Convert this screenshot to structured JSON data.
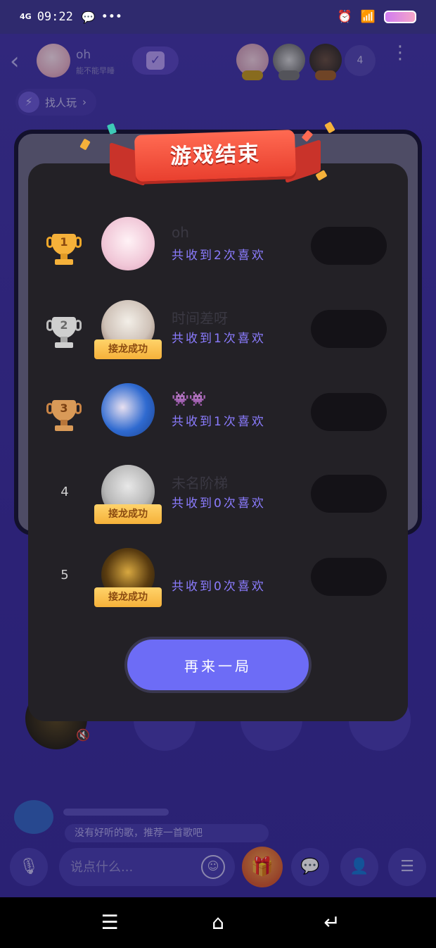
{
  "status_bar": {
    "network": "4G",
    "time": "09:22",
    "icons": [
      "wechat-icon",
      "more-dots-icon",
      "alarm-icon",
      "wifi-icon",
      "battery-icon"
    ],
    "dots": "•••"
  },
  "room": {
    "owner_name": "oh",
    "owner_status": "能不能早睡",
    "member_count": "4",
    "find_play_label": "找人玩",
    "chat_preview": "没有好听的歌，推荐一首歌吧",
    "input_placeholder": "说点什么..."
  },
  "modal": {
    "title": "游戏结束",
    "rows": [
      {
        "rank": "1",
        "name": "oh",
        "likes": "共收到2次喜欢",
        "badge": ""
      },
      {
        "rank": "2",
        "name": "时间差呀",
        "likes": "共收到1次喜欢",
        "badge": "接龙成功"
      },
      {
        "rank": "3",
        "name": "👾👾",
        "likes": "共收到1次喜欢",
        "badge": ""
      },
      {
        "rank": "4",
        "name": "未名阶梯",
        "likes": "共收到0次喜欢",
        "badge": "接龙成功"
      },
      {
        "rank": "5",
        "name": "",
        "likes": "共收到0次喜欢",
        "badge": "接龙成功"
      }
    ],
    "again_label": "再来一局"
  },
  "colors": {
    "accent": "#6d6cf6",
    "likes_text": "#8b7cff",
    "banner_red": "#e9402f",
    "gold": "#f5b13a",
    "silver": "#c8c8c8",
    "bronze": "#d08a4a"
  }
}
